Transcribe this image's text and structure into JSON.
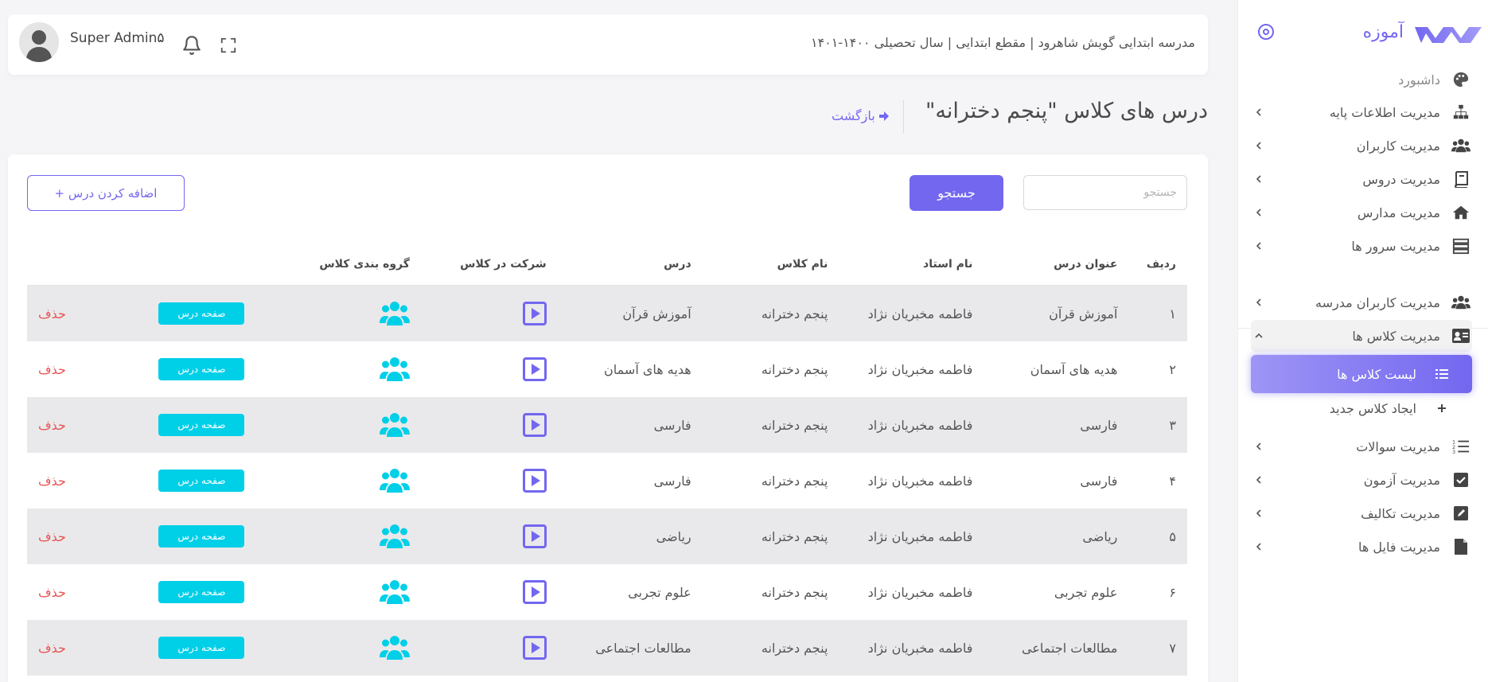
{
  "brand": {
    "name": "آموزه"
  },
  "sidebar": {
    "items": [
      {
        "label": "داشبورد",
        "icon": "palette-icon",
        "name": "sidebar-item-dashboard",
        "chevron": false,
        "dim": true
      },
      {
        "label": "مدیریت اطلاعات پایه",
        "icon": "sitemap-icon",
        "name": "sidebar-item-base-info",
        "chevron": true
      },
      {
        "label": "مدیریت کاربران",
        "icon": "users-icon",
        "name": "sidebar-item-users",
        "chevron": true
      },
      {
        "label": "مدیریت دروس",
        "icon": "book-icon",
        "name": "sidebar-item-courses",
        "chevron": true
      },
      {
        "label": "مدیریت مدارس",
        "icon": "home-icon",
        "name": "sidebar-item-schools",
        "chevron": true
      },
      {
        "label": "مدیریت سرور ها",
        "icon": "server-icon",
        "name": "sidebar-item-servers",
        "chevron": true
      },
      {
        "label": "مدیریت کاربران مدرسه",
        "icon": "users-icon",
        "name": "sidebar-item-school-users",
        "chevron": true
      },
      {
        "label": "مدیریت کلاس ها",
        "icon": "id-card-icon",
        "name": "sidebar-item-classes",
        "chevron": true,
        "open": true
      },
      {
        "label": "لیست کلاس ها",
        "icon": "list-icon",
        "name": "sidebar-item-class-list",
        "active": true
      },
      {
        "label": "ایجاد کلاس جدید",
        "icon": "plus-icon",
        "name": "sidebar-item-new-class"
      },
      {
        "label": "مدیریت سوالات",
        "icon": "ordered-list-icon",
        "name": "sidebar-item-questions",
        "chevron": true
      },
      {
        "label": "مدیریت آزمون",
        "icon": "checkbox-icon",
        "name": "sidebar-item-exams",
        "chevron": true
      },
      {
        "label": "مدیریت تکالیف",
        "icon": "edit-icon",
        "name": "sidebar-item-assignments",
        "chevron": true
      },
      {
        "label": "مدیریت فایل ها",
        "icon": "file-icon",
        "name": "sidebar-item-files",
        "chevron": true
      }
    ]
  },
  "header": {
    "school_info": "مدرسه ابتدایی گویش شاهرود | مقطع ابتدایی | سال تحصیلی ۱۴۰۰-۱۴۰۱",
    "user_name": "Super Admin۵"
  },
  "page": {
    "title": "درس های کلاس \"پنجم دخترانه\"",
    "back_label": "بازگشت"
  },
  "toolbar": {
    "search_placeholder": "جستجو",
    "search_button": "جستجو",
    "add_button": "اضافه کردن درس +"
  },
  "table": {
    "headers": [
      "ردیف",
      "عنوان درس",
      "نام استاد",
      "نام کلاس",
      "درس",
      "شرکت در کلاس",
      "گروه بندی کلاس",
      "",
      ""
    ],
    "lesson_page_label": "صفحه درس",
    "delete_label": "حذف",
    "rows": [
      {
        "index": "۱",
        "title": "آموزش قرآن",
        "teacher": "فاطمه مخبریان نژاد",
        "class": "پنجم دخترانه",
        "course": "آموزش قرآن"
      },
      {
        "index": "۲",
        "title": "هدیه های آسمان",
        "teacher": "فاطمه مخبریان نژاد",
        "class": "پنجم دخترانه",
        "course": "هدیه های آسمان"
      },
      {
        "index": "۳",
        "title": "فارسی",
        "teacher": "فاطمه مخبریان نژاد",
        "class": "پنجم دخترانه",
        "course": "فارسی"
      },
      {
        "index": "۴",
        "title": "فارسی",
        "teacher": "فاطمه مخبریان نژاد",
        "class": "پنجم دخترانه",
        "course": "فارسی"
      },
      {
        "index": "۵",
        "title": "ریاضی",
        "teacher": "فاطمه مخبریان نژاد",
        "class": "پنجم دخترانه",
        "course": "ریاضی"
      },
      {
        "index": "۶",
        "title": "علوم تجربی",
        "teacher": "فاطمه مخبریان نژاد",
        "class": "پنجم دخترانه",
        "course": "علوم تجربی"
      },
      {
        "index": "۷",
        "title": "مطالعات اجتماعی",
        "teacher": "فاطمه مخبریان نژاد",
        "class": "پنجم دخترانه",
        "course": "مطالعات اجتماعی"
      }
    ]
  },
  "colors": {
    "primary": "#7367f0",
    "info": "#00cfe8",
    "danger": "#ea5455",
    "stripe": "#e9e9eb"
  }
}
